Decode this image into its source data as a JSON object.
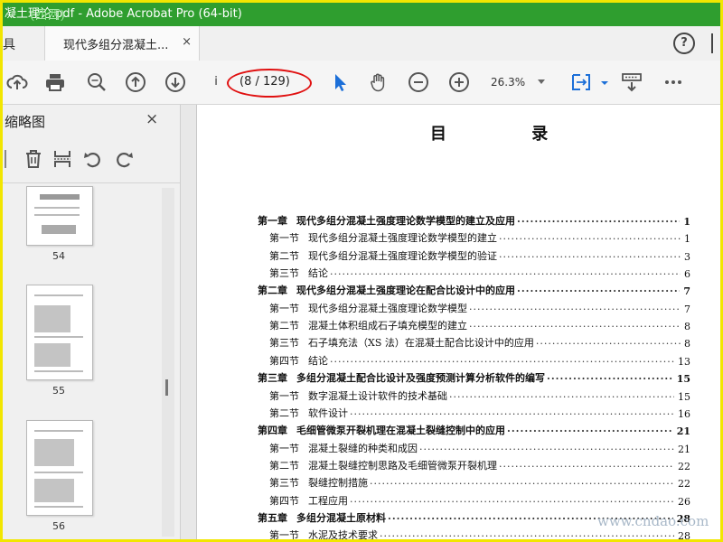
{
  "window": {
    "title": "凝土理论.pdf - Adobe Acrobat Pro (64-bit)",
    "watermark_logo": "西西软件园"
  },
  "tabs": {
    "left_stub": "具",
    "active_label": "现代多组分混凝土...",
    "close_glyph": "×",
    "help_glyph": "?"
  },
  "toolbar": {
    "page_input": "i",
    "page_count": "(8 / 129)",
    "zoom": "26.3%",
    "icons": [
      "upload-icon",
      "print-icon",
      "zoom-search-icon",
      "page-up-icon",
      "page-down-icon",
      "select-arrow-icon",
      "hand-icon",
      "zoom-out-icon",
      "zoom-in-icon",
      "fit-page-icon",
      "scroll-mode-icon",
      "more-icon"
    ],
    "highlight_color": "#e01010"
  },
  "thumbnails": {
    "panel_title": "缩略图",
    "close_glyph": "×",
    "tools": [
      "delete-icon",
      "extract-icon",
      "rotate-ccw-icon",
      "rotate-cw-icon"
    ],
    "pages": [
      {
        "number": "54"
      },
      {
        "number": "55"
      },
      {
        "number": "56"
      }
    ]
  },
  "document": {
    "toc_title": "目 录",
    "rows": [
      {
        "label": "第一章",
        "title": "现代多组分混凝土强度理论数学模型的建立及应用",
        "page": "1",
        "chapter": true
      },
      {
        "label": "第一节",
        "title": "现代多组分混凝土强度理论数学模型的建立",
        "page": "1",
        "chapter": false
      },
      {
        "label": "第二节",
        "title": "现代多组分混凝土强度理论数学模型的验证",
        "page": "3",
        "chapter": false
      },
      {
        "label": "第三节",
        "title": "结论",
        "page": "6",
        "chapter": false
      },
      {
        "label": "第二章",
        "title": "现代多组分混凝土强度理论在配合比设计中的应用",
        "page": "7",
        "chapter": true
      },
      {
        "label": "第一节",
        "title": "现代多组分混凝土强度理论数学模型",
        "page": "7",
        "chapter": false
      },
      {
        "label": "第二节",
        "title": "混凝土体积组成石子填充模型的建立",
        "page": "8",
        "chapter": false
      },
      {
        "label": "第三节",
        "title": "石子填充法（XS 法）在混凝土配合比设计中的应用",
        "page": "8",
        "chapter": false
      },
      {
        "label": "第四节",
        "title": "结论",
        "page": "13",
        "chapter": false
      },
      {
        "label": "第三章",
        "title": "多组分混凝土配合比设计及强度预测计算分析软件的编写",
        "page": "15",
        "chapter": true
      },
      {
        "label": "第一节",
        "title": "数字混凝土设计软件的技术基础",
        "page": "15",
        "chapter": false
      },
      {
        "label": "第二节",
        "title": "软件设计",
        "page": "16",
        "chapter": false
      },
      {
        "label": "第四章",
        "title": "毛细管微泵开裂机理在混凝土裂缝控制中的应用",
        "page": "21",
        "chapter": true
      },
      {
        "label": "第一节",
        "title": "混凝土裂缝的种类和成因",
        "page": "21",
        "chapter": false
      },
      {
        "label": "第二节",
        "title": "混凝土裂缝控制思路及毛细管微泵开裂机理",
        "page": "22",
        "chapter": false
      },
      {
        "label": "第三节",
        "title": "裂缝控制措施",
        "page": "22",
        "chapter": false
      },
      {
        "label": "第四节",
        "title": "工程应用",
        "page": "26",
        "chapter": false
      },
      {
        "label": "第五章",
        "title": "多组分混凝土原材料",
        "page": "28",
        "chapter": true
      },
      {
        "label": "第一节",
        "title": "水泥及技术要求",
        "page": "28",
        "chapter": false
      }
    ]
  },
  "site_watermark": "www.cndao.com"
}
